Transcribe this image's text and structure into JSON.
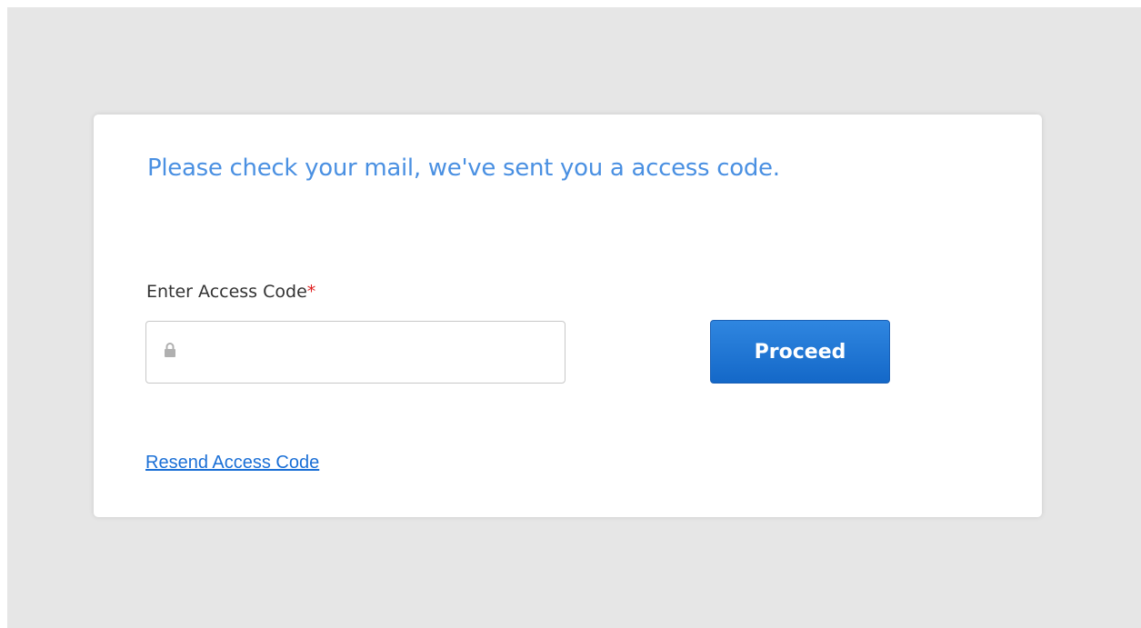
{
  "card": {
    "headline": "Please check your mail, we've sent you a access code.",
    "field_label": "Enter Access Code",
    "required_mark": "*",
    "code_input": {
      "value": "",
      "placeholder": "",
      "icon": "lock-icon"
    },
    "proceed_label": "Proceed",
    "resend_label": "Resend Access Code"
  },
  "colors": {
    "headline": "#4a90e2",
    "required": "#e02020",
    "button": "#1a73d6",
    "link": "#1a6fd6",
    "background": "#e6e6e6"
  }
}
